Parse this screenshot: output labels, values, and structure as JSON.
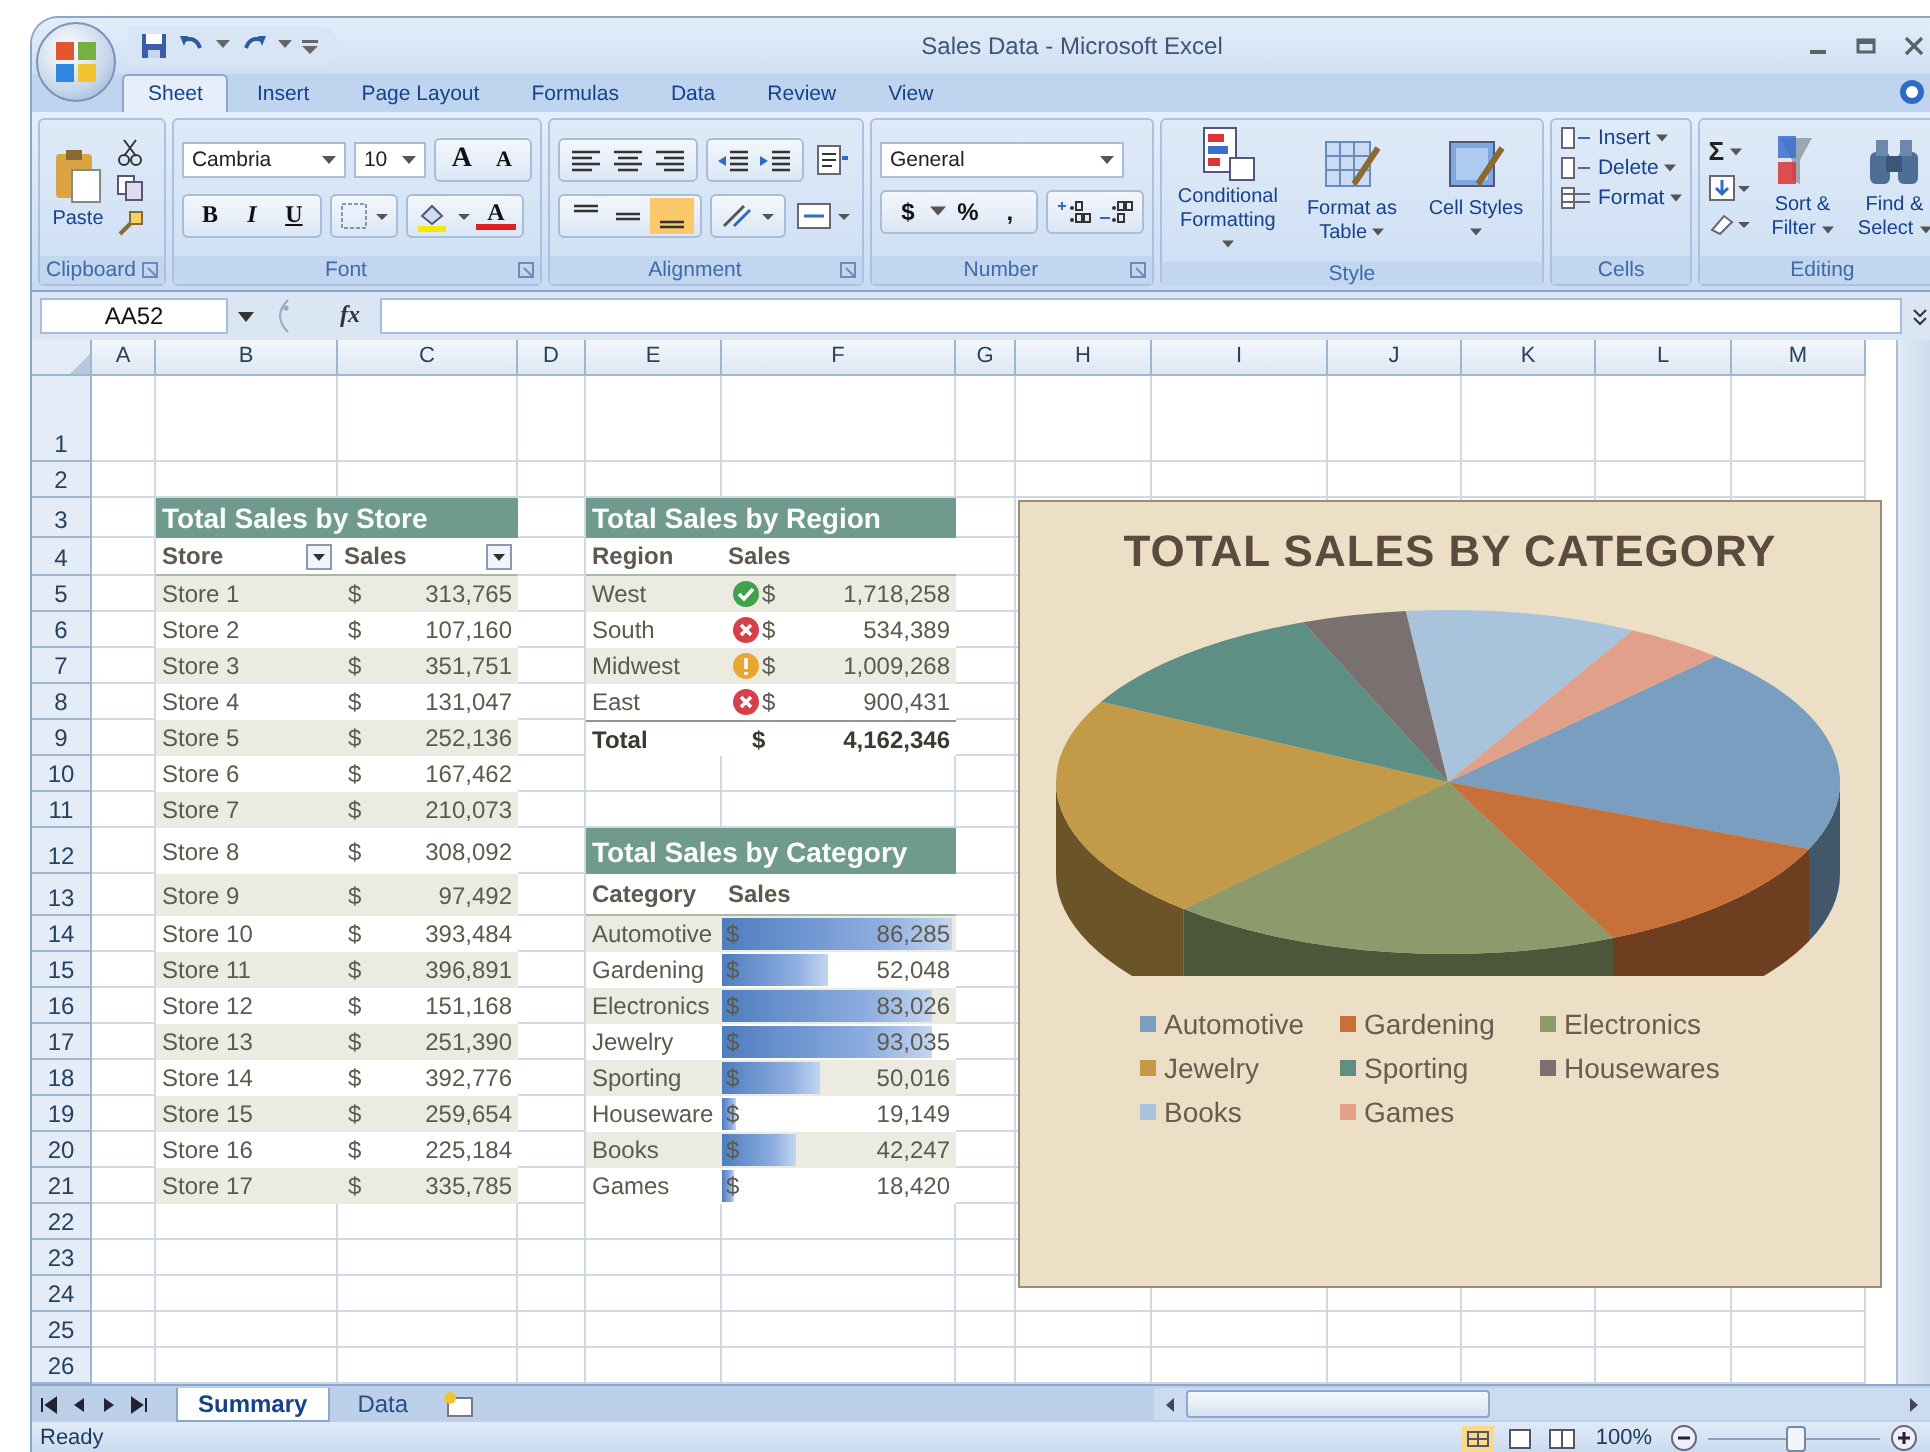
{
  "window": {
    "title": "Sales Data - Microsoft Excel"
  },
  "ribbon_tabs": [
    {
      "label": "Sheet",
      "selected": true
    },
    {
      "label": "Insert",
      "selected": false
    },
    {
      "label": "Page Layout",
      "selected": false
    },
    {
      "label": "Formulas",
      "selected": false
    },
    {
      "label": "Data",
      "selected": false
    },
    {
      "label": "Review",
      "selected": false
    },
    {
      "label": "View",
      "selected": false
    }
  ],
  "ribbon": {
    "clipboard": {
      "label": "Clipboard",
      "paste": "Paste"
    },
    "font": {
      "label": "Font",
      "family": "Cambria",
      "size": "10",
      "grow": "A",
      "shrink": "A",
      "style_buttons": [
        "B",
        "I",
        "U"
      ],
      "font_color": "A"
    },
    "alignment": {
      "label": "Alignment"
    },
    "number": {
      "label": "Number",
      "format": "General",
      "buttons": [
        "$",
        "%",
        ","
      ]
    },
    "style": {
      "label": "Style",
      "buttons": [
        "Conditional Formatting",
        "Format as Table",
        "Cell Styles"
      ]
    },
    "cells": {
      "label": "Cells",
      "buttons": [
        "Insert",
        "Delete",
        "Format"
      ]
    },
    "editing": {
      "label": "Editing",
      "sum": "Σ",
      "buttons": [
        "Sort & Filter",
        "Find & Select"
      ]
    }
  },
  "formula_bar": {
    "name_box": "AA52",
    "fx": "fx"
  },
  "sheet": {
    "columns": [
      "A",
      "B",
      "C",
      "D",
      "E",
      "F",
      "G",
      "H",
      "I",
      "J",
      "K",
      "L",
      "M"
    ],
    "rows": [
      "1",
      "2",
      "3",
      "4",
      "5",
      "6",
      "7",
      "8",
      "9",
      "10",
      "11",
      "12",
      "13",
      "14",
      "15",
      "16",
      "17",
      "18",
      "19",
      "20",
      "21",
      "22",
      "23",
      "24",
      "25",
      "26"
    ]
  },
  "store_table": {
    "title": "Total Sales by Store",
    "headers": [
      "Store",
      "Sales"
    ],
    "rows": [
      {
        "store": "Store 1",
        "currency": "$",
        "sales": "313,765"
      },
      {
        "store": "Store 2",
        "currency": "$",
        "sales": "107,160"
      },
      {
        "store": "Store 3",
        "currency": "$",
        "sales": "351,751"
      },
      {
        "store": "Store 4",
        "currency": "$",
        "sales": "131,047"
      },
      {
        "store": "Store 5",
        "currency": "$",
        "sales": "252,136"
      },
      {
        "store": "Store 6",
        "currency": "$",
        "sales": "167,462"
      },
      {
        "store": "Store 7",
        "currency": "$",
        "sales": "210,073"
      },
      {
        "store": "Store 8",
        "currency": "$",
        "sales": "308,092"
      },
      {
        "store": "Store 9",
        "currency": "$",
        "sales": "97,492"
      },
      {
        "store": "Store 10",
        "currency": "$",
        "sales": "393,484"
      },
      {
        "store": "Store 11",
        "currency": "$",
        "sales": "396,891"
      },
      {
        "store": "Store 12",
        "currency": "$",
        "sales": "151,168"
      },
      {
        "store": "Store 13",
        "currency": "$",
        "sales": "251,390"
      },
      {
        "store": "Store 14",
        "currency": "$",
        "sales": "392,776"
      },
      {
        "store": "Store 15",
        "currency": "$",
        "sales": "259,654"
      },
      {
        "store": "Store 16",
        "currency": "$",
        "sales": "225,184"
      },
      {
        "store": "Store 17",
        "currency": "$",
        "sales": "335,785"
      }
    ]
  },
  "region_table": {
    "title": "Total Sales by Region",
    "headers": [
      "Region",
      "Sales"
    ],
    "rows": [
      {
        "region": "West",
        "kind": "check",
        "currency": "$",
        "sales": "1,718,258"
      },
      {
        "region": "South",
        "kind": "cross",
        "currency": "$",
        "sales": "534,389"
      },
      {
        "region": "Midwest",
        "kind": "exclamation",
        "currency": "$",
        "sales": "1,009,268"
      },
      {
        "region": "East",
        "kind": "cross",
        "currency": "$",
        "sales": "900,431"
      }
    ],
    "total": {
      "label": "Total",
      "currency": "$",
      "sales": "4,162,346"
    }
  },
  "category_table": {
    "title": "Total Sales by Category",
    "headers": [
      "Category",
      "Sales"
    ],
    "rows": [
      {
        "category": "Automotive",
        "currency": "$",
        "sales": "86,285",
        "level": 0.98
      },
      {
        "category": "Gardening",
        "currency": "$",
        "sales": "52,048",
        "level": 0.45
      },
      {
        "category": "Electronics",
        "currency": "$",
        "sales": "83,026",
        "level": 0.9
      },
      {
        "category": "Jewelry",
        "currency": "$",
        "sales": "93,035",
        "level": 0.9
      },
      {
        "category": "Sporting",
        "currency": "$",
        "sales": "50,016",
        "level": 0.42
      },
      {
        "category": "Houseware",
        "currency": "$",
        "sales": "19,149",
        "level": 0.06
      },
      {
        "category": "Books",
        "currency": "$",
        "sales": "42,247",
        "level": 0.32
      },
      {
        "category": "Games",
        "currency": "$",
        "sales": "18,420",
        "level": 0.05
      }
    ]
  },
  "chart": {
    "title": "TOTAL SALES BY CATEGORY",
    "legend": [
      {
        "label": "Automotive",
        "color": "#7a9ec0"
      },
      {
        "label": "Gardening",
        "color": "#c8703a"
      },
      {
        "label": "Electronics",
        "color": "#8c9a6c"
      },
      {
        "label": "Jewelry",
        "color": "#c29a48"
      },
      {
        "label": "Sporting",
        "color": "#5e8f84"
      },
      {
        "label": "Housewares",
        "color": "#7a7070"
      },
      {
        "label": "Books",
        "color": "#a8c4dc"
      },
      {
        "label": "Games",
        "color": "#e0a08a"
      }
    ]
  },
  "sheet_tabs": [
    {
      "label": "Summary",
      "selected": true
    },
    {
      "label": "Data",
      "selected": false
    }
  ],
  "status_bar": {
    "status": "Ready",
    "zoom": "100%",
    "zoom_level": {
      "level": 0.5
    }
  }
}
